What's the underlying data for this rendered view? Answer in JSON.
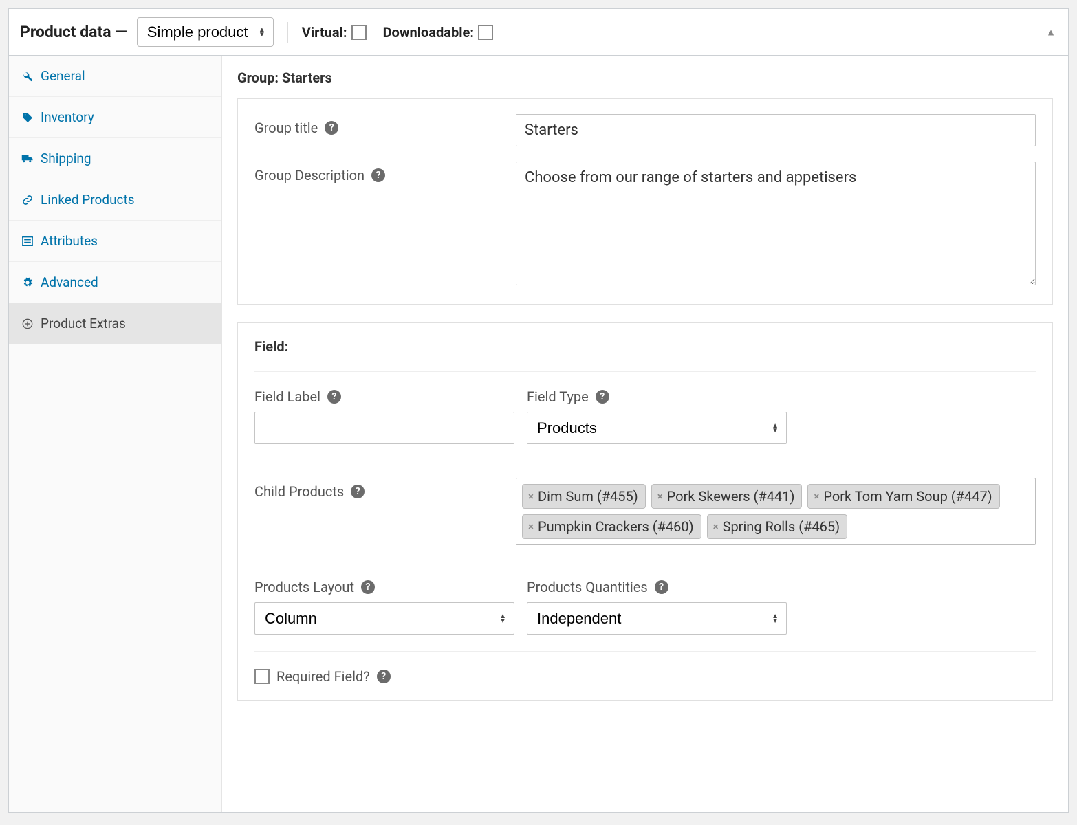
{
  "header": {
    "title_prefix": "Product data —",
    "product_type": "Simple product",
    "virtual_label": "Virtual:",
    "downloadable_label": "Downloadable:"
  },
  "sidebar": {
    "items": [
      {
        "label": "General",
        "icon": "wrench"
      },
      {
        "label": "Inventory",
        "icon": "tag"
      },
      {
        "label": "Shipping",
        "icon": "truck"
      },
      {
        "label": "Linked Products",
        "icon": "link"
      },
      {
        "label": "Attributes",
        "icon": "list"
      },
      {
        "label": "Advanced",
        "icon": "gear"
      },
      {
        "label": "Product Extras",
        "icon": "plus-circle"
      }
    ]
  },
  "group": {
    "heading": "Group: Starters",
    "title_label": "Group title",
    "title_value": "Starters",
    "desc_label": "Group Description",
    "desc_value": "Choose from our range of starters and appetisers"
  },
  "field": {
    "heading": "Field:",
    "label_label": "Field Label",
    "label_value": "",
    "type_label": "Field Type",
    "type_value": "Products",
    "child_label": "Child Products",
    "child_products": [
      "Dim Sum (#455)",
      "Pork Skewers (#441)",
      "Pork Tom Yam Soup (#447)",
      "Pumpkin Crackers (#460)",
      "Spring Rolls (#465)"
    ],
    "layout_label": "Products Layout",
    "layout_value": "Column",
    "qty_label": "Products Quantities",
    "qty_value": "Independent",
    "required_label": "Required Field?"
  }
}
